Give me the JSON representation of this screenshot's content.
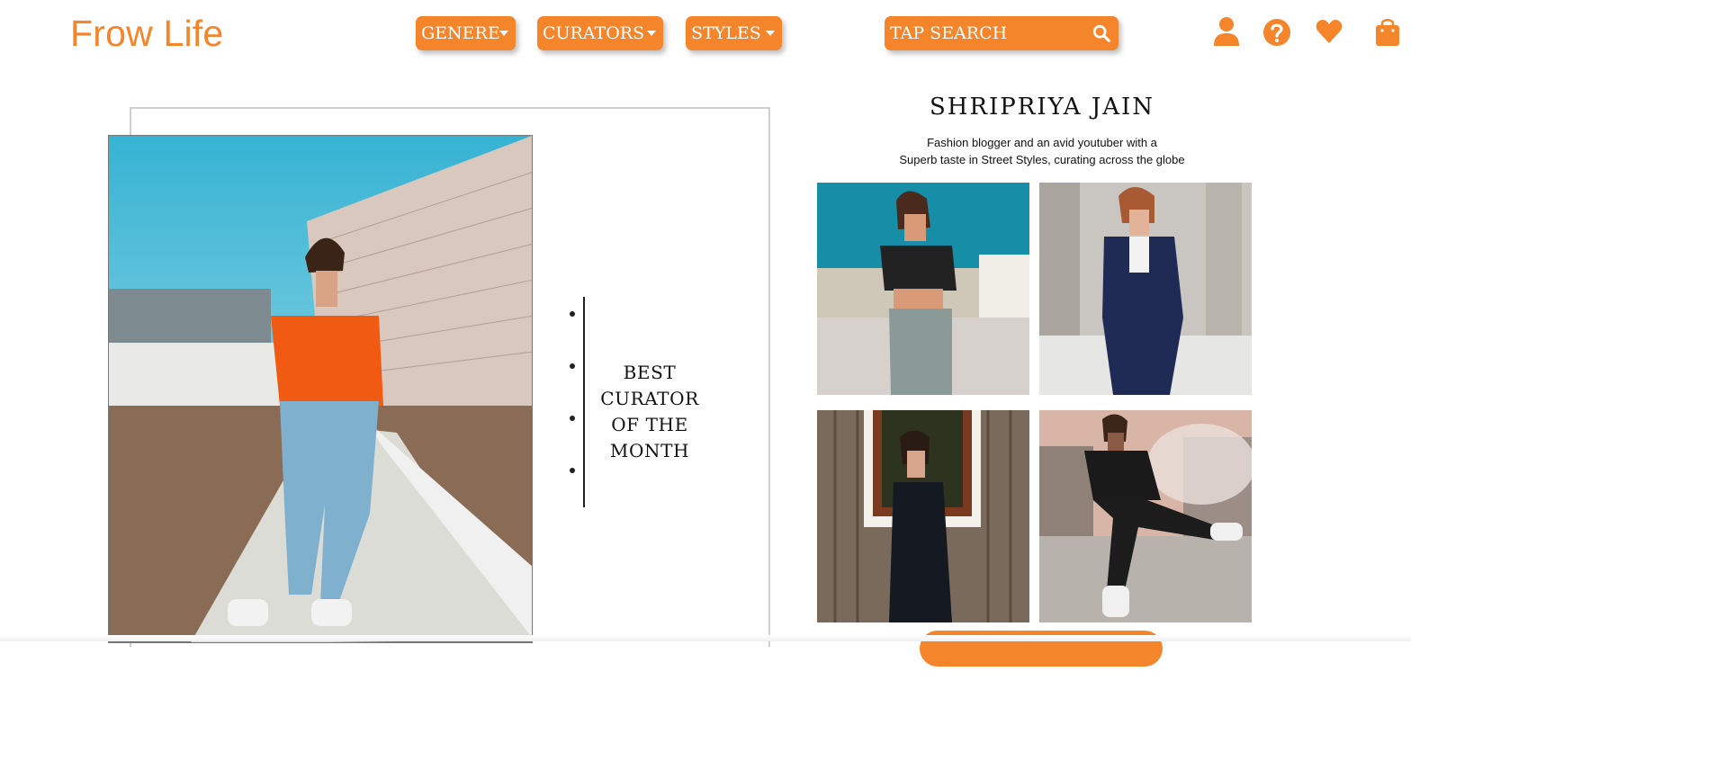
{
  "brand": {
    "logo": "Frow Life",
    "accent": "#f5852b"
  },
  "nav": {
    "genere": "GENERE",
    "curators": "CURATORS",
    "styles": "STYLES"
  },
  "search": {
    "placeholder": "TAP SEARCH"
  },
  "icons": [
    "user-icon",
    "help-icon",
    "heart-icon",
    "shopping-bag-icon",
    "search-icon",
    "chevron-down-icon"
  ],
  "feature": {
    "award_lines": [
      "BEST",
      "CURATOR",
      "OF THE",
      "MONTH"
    ]
  },
  "curator": {
    "name": "SHRIPRIYA JAIN",
    "bio_lines": [
      "Fashion blogger and an avid youtuber with a",
      "Superb taste in Street Styles, curating across the globe"
    ]
  }
}
